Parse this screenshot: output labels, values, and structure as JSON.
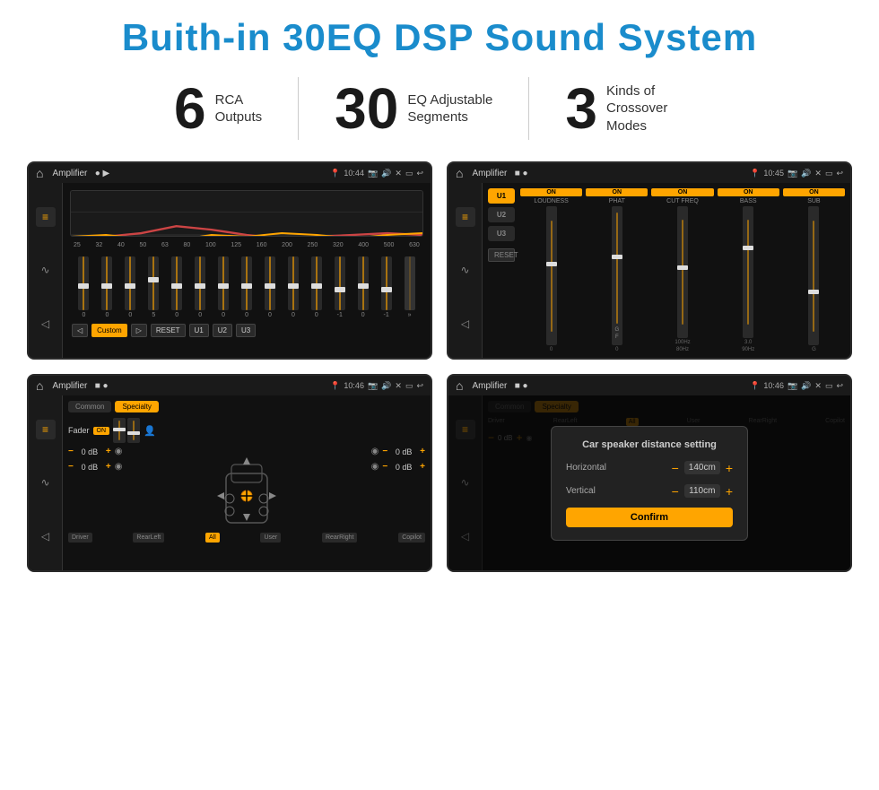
{
  "title": "Buith-in 30EQ DSP Sound System",
  "stats": [
    {
      "number": "6",
      "label": "RCA\nOutputs"
    },
    {
      "number": "30",
      "label": "EQ Adjustable\nSegments"
    },
    {
      "number": "3",
      "label": "Kinds of\nCrossover Modes"
    }
  ],
  "screens": [
    {
      "id": "eq-screen",
      "statusBar": {
        "title": "Amplifier",
        "time": "10:44"
      }
    },
    {
      "id": "crossover-screen",
      "statusBar": {
        "title": "Amplifier",
        "time": "10:45"
      }
    },
    {
      "id": "fader-screen",
      "statusBar": {
        "title": "Amplifier",
        "time": "10:46"
      }
    },
    {
      "id": "dialog-screen",
      "statusBar": {
        "title": "Amplifier",
        "time": "10:46"
      },
      "dialog": {
        "title": "Car speaker distance setting",
        "horizontal_label": "Horizontal",
        "horizontal_value": "140cm",
        "vertical_label": "Vertical",
        "vertical_value": "110cm",
        "confirm_label": "Confirm"
      }
    }
  ],
  "eq": {
    "freqs": [
      "25",
      "32",
      "40",
      "50",
      "63",
      "80",
      "100",
      "125",
      "160",
      "200",
      "250",
      "320",
      "400",
      "500",
      "630"
    ],
    "values": [
      "0",
      "0",
      "0",
      "5",
      "0",
      "0",
      "0",
      "0",
      "0",
      "0",
      "0",
      "-1",
      "0",
      "-1",
      ""
    ],
    "buttons": [
      "Custom",
      "RESET",
      "U1",
      "U2",
      "U3"
    ]
  },
  "crossover": {
    "presets": [
      "U1",
      "U2",
      "U3"
    ],
    "channels": [
      {
        "name": "LOUDNESS",
        "on": true
      },
      {
        "name": "PHAT",
        "on": true
      },
      {
        "name": "CUT FREQ",
        "on": true
      },
      {
        "name": "BASS",
        "on": true
      },
      {
        "name": "SUB",
        "on": true
      }
    ],
    "reset_label": "RESET"
  },
  "fader": {
    "tabs": [
      "Common",
      "Specialty"
    ],
    "fader_label": "Fader",
    "on_label": "ON",
    "labels": [
      "Driver",
      "RearLeft",
      "All",
      "User",
      "RearRight",
      "Copilot"
    ],
    "db_values": [
      "0 dB",
      "0 dB",
      "0 dB",
      "0 dB"
    ]
  },
  "dialog": {
    "title": "Car speaker distance setting",
    "horizontal_label": "Horizontal",
    "horizontal_value": "140cm",
    "vertical_label": "Vertical",
    "vertical_value": "110cm",
    "confirm_label": "Confirm"
  }
}
